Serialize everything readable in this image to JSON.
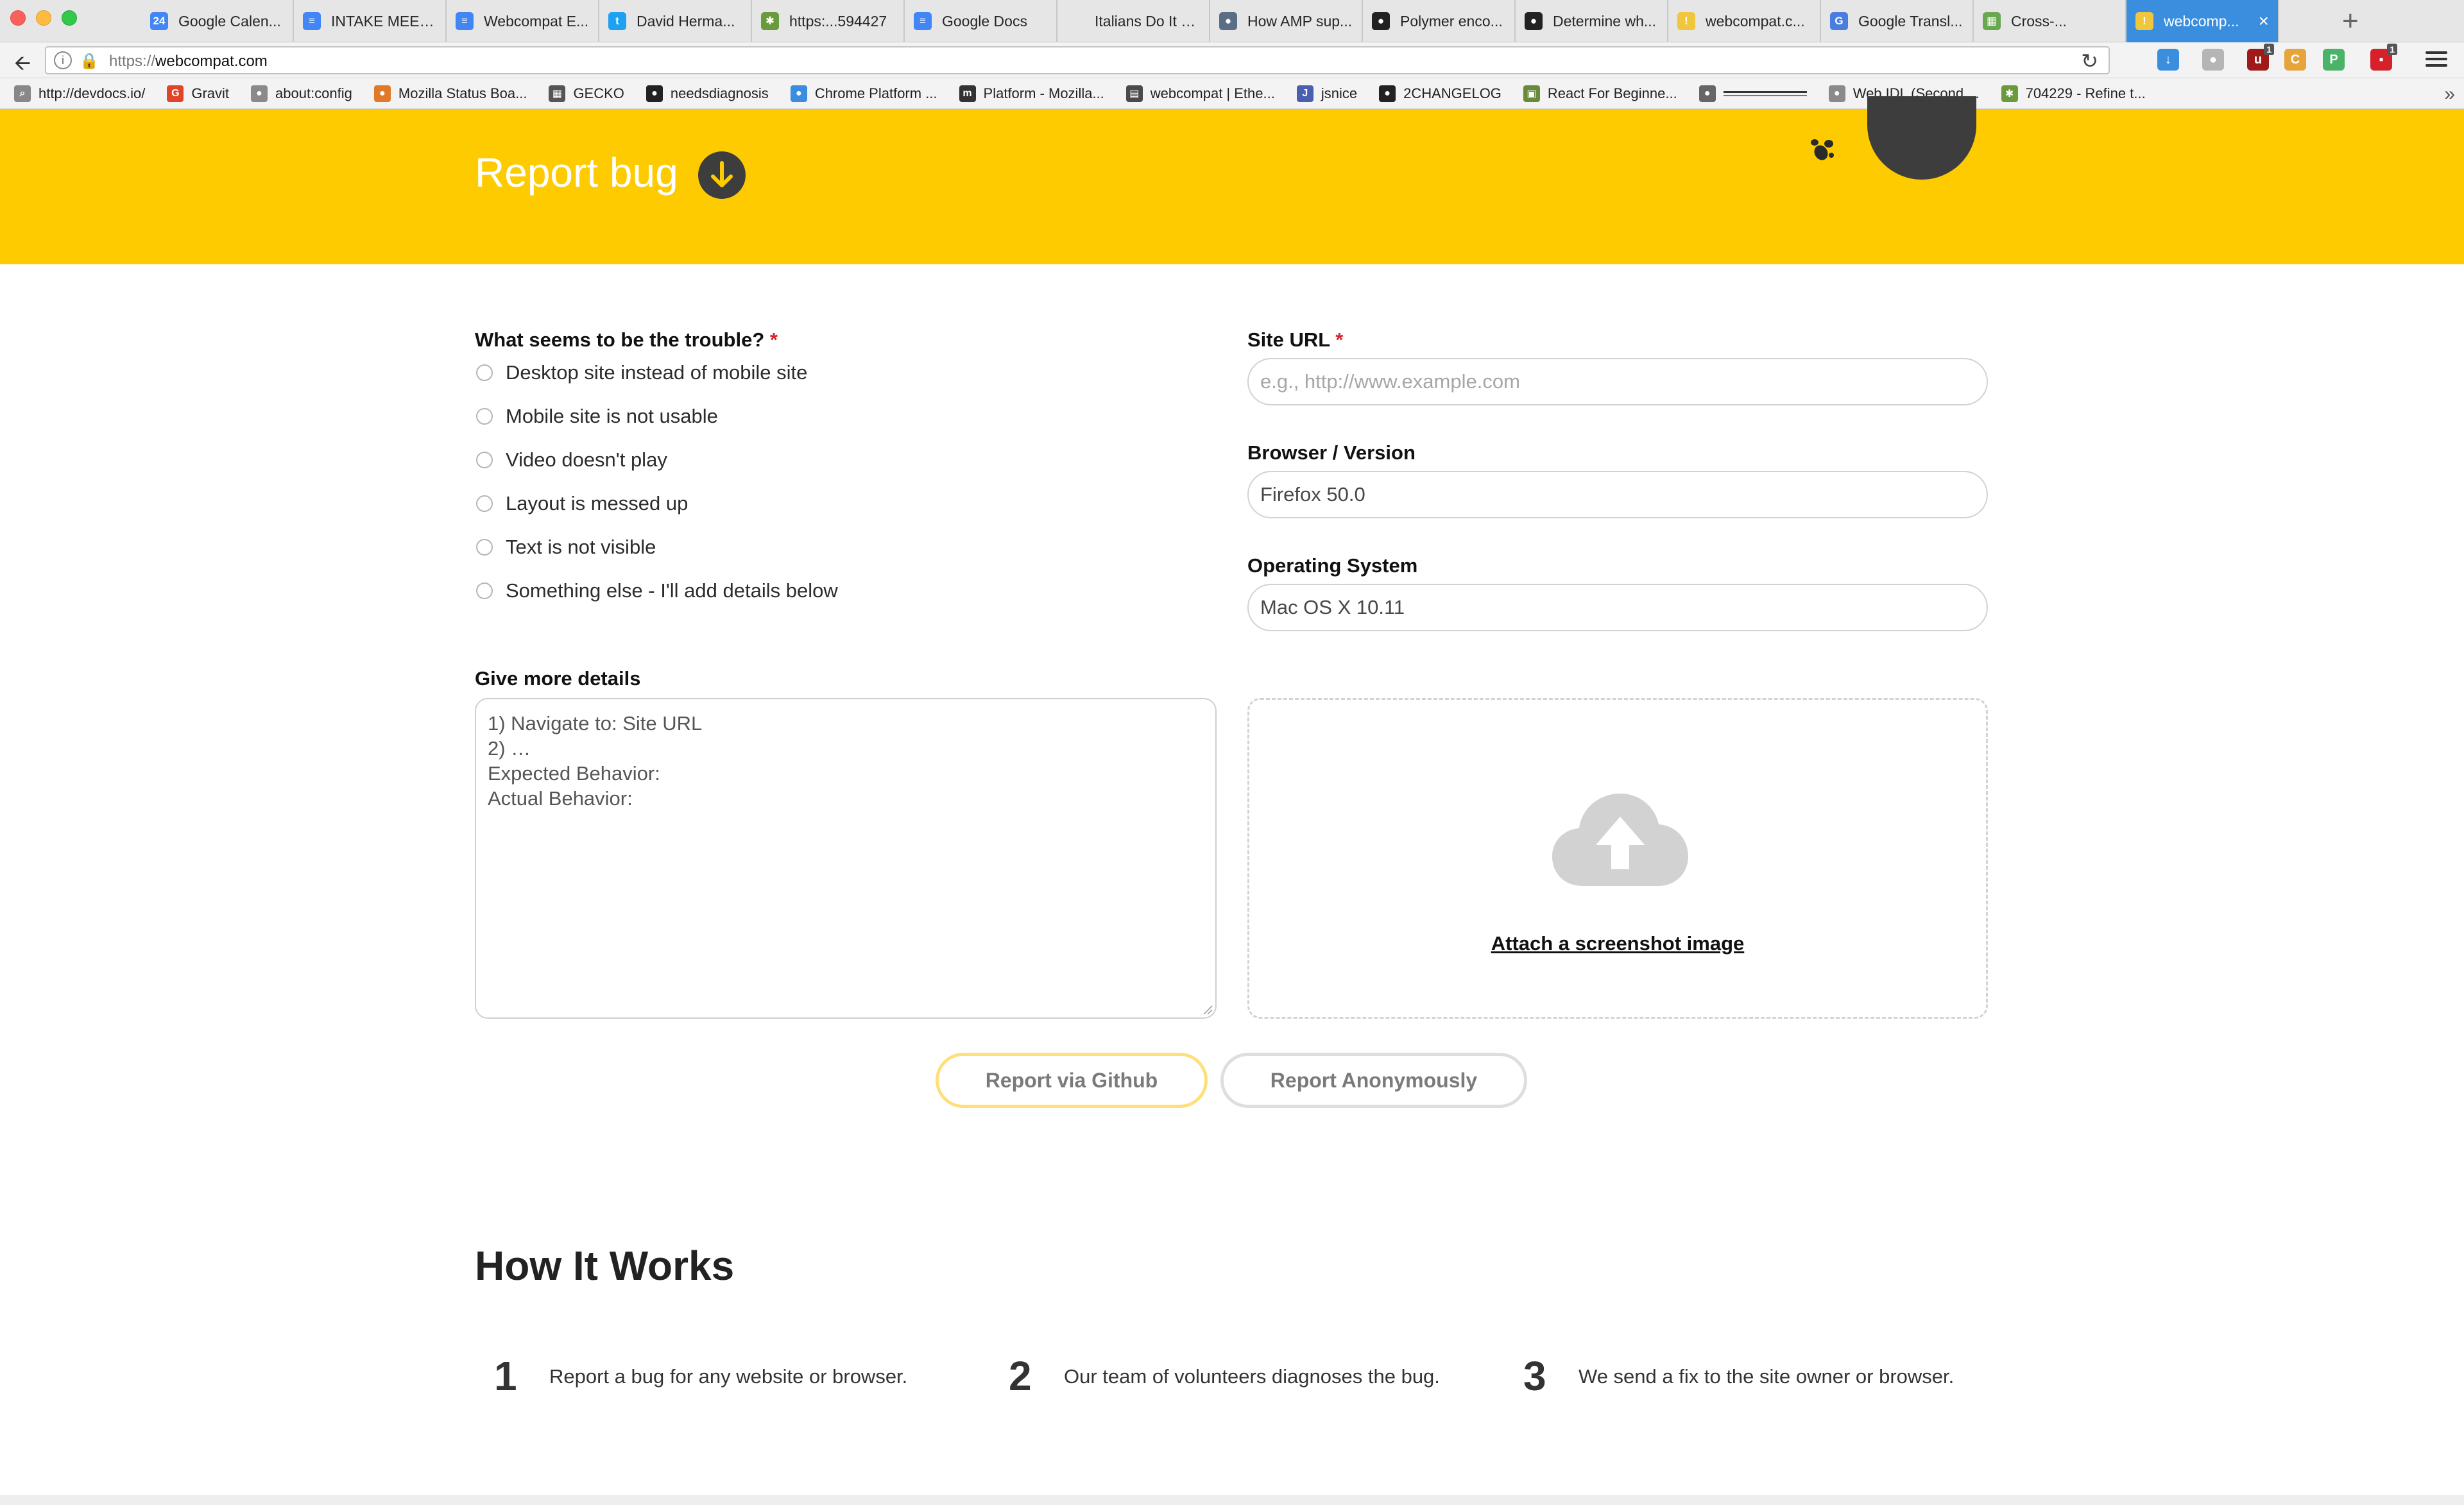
{
  "browser": {
    "tabs": [
      {
        "label": "Google Calen...",
        "icon": "calendar-icon",
        "color": "#4285f4",
        "glyph": "24"
      },
      {
        "label": "INTAKE MEET...",
        "icon": "docs-icon",
        "color": "#4285f4",
        "glyph": "≡"
      },
      {
        "label": "Webcompat E...",
        "icon": "docs-icon",
        "color": "#4285f4",
        "glyph": "≡"
      },
      {
        "label": "David Herma...",
        "icon": "twitter-icon",
        "color": "#1da1f2",
        "glyph": "t"
      },
      {
        "label": "https:...594427",
        "icon": "bug-icon",
        "color": "#6a9a3c",
        "glyph": "✱"
      },
      {
        "label": "Google Docs",
        "icon": "docs-icon",
        "color": "#4285f4",
        "glyph": "≡"
      },
      {
        "label": "Italians Do It Bett...",
        "icon": "blank-icon",
        "color": "#e6e6e6",
        "glyph": ""
      },
      {
        "label": "How AMP sup...",
        "icon": "globe-icon",
        "color": "#5a6e85",
        "glyph": "●"
      },
      {
        "label": "Polymer enco...",
        "icon": "github-icon",
        "color": "#222222",
        "glyph": "●"
      },
      {
        "label": "Determine wh...",
        "icon": "github-icon",
        "color": "#222222",
        "glyph": "●"
      },
      {
        "label": "webcompat.c...",
        "icon": "webcompat-icon",
        "color": "#f0c63c",
        "glyph": "!"
      },
      {
        "label": "Google Transl...",
        "icon": "translate-icon",
        "color": "#4a7de0",
        "glyph": "G"
      },
      {
        "label": "Cross-...",
        "icon": "table-icon",
        "color": "#6aa84f",
        "glyph": "▦"
      },
      {
        "label": "webcomp...",
        "icon": "webcompat-icon",
        "color": "#f0c63c",
        "glyph": "!",
        "active": true
      }
    ],
    "url_prefix": "https://",
    "url": "webcompat.com",
    "bookmarks": [
      {
        "label": "http://devdocs.io/",
        "icon": "search-icon",
        "color": "#888888",
        "glyph": "⌕"
      },
      {
        "label": "Gravit",
        "icon": "gravit-icon",
        "color": "#e0452a",
        "glyph": "G"
      },
      {
        "label": "about:config",
        "icon": "globe-icon",
        "color": "#8a8a8a",
        "glyph": "●"
      },
      {
        "label": "Mozilla Status Boa...",
        "icon": "firefox-icon",
        "color": "#e07a2a",
        "glyph": "●"
      },
      {
        "label": "GECKO",
        "icon": "grid-icon",
        "color": "#555555",
        "glyph": "▦"
      },
      {
        "label": "needsdiagnosis",
        "icon": "github-icon",
        "color": "#222222",
        "glyph": "●"
      },
      {
        "label": "Chrome Platform ...",
        "icon": "chrome-icon",
        "color": "#3a8de0",
        "glyph": "●"
      },
      {
        "label": "Platform - Mozilla...",
        "icon": "mozilla-icon",
        "color": "#333333",
        "glyph": "m"
      },
      {
        "label": "webcompat | Ethe...",
        "icon": "etherpad-icon",
        "color": "#4a4a4a",
        "glyph": "▤"
      },
      {
        "label": "jsnice",
        "icon": "jsnice-icon",
        "color": "#4a5fb0",
        "glyph": "J"
      },
      {
        "label": "2CHANGELOG",
        "icon": "github-icon",
        "color": "#222222",
        "glyph": "●"
      },
      {
        "label": "React For Beginne...",
        "icon": "react-icon",
        "color": "#6a8a3a",
        "glyph": "▣"
      },
      {
        "label": "",
        "icon": "bookmark-image-icon",
        "color": "#666666",
        "glyph": "●"
      },
      {
        "label": "Web IDL (Second ...",
        "icon": "globe-icon",
        "color": "#8a8a8a",
        "glyph": "●"
      },
      {
        "label": "704229 - Refine t...",
        "icon": "bug-icon",
        "color": "#6a9a3c",
        "glyph": "✱"
      }
    ],
    "toolbar_icons": [
      {
        "name": "downloads-icon",
        "color": "#3b8ede",
        "glyph": "↓",
        "badge": ""
      },
      {
        "name": "extension-gray-icon",
        "color": "#b5b5b5",
        "glyph": "●",
        "badge": ""
      },
      {
        "name": "ublock-icon",
        "color": "#a01a1a",
        "glyph": "u",
        "badge": "1"
      },
      {
        "name": "color-picker-icon",
        "color": "#e6a43a",
        "glyph": "C",
        "badge": ""
      },
      {
        "name": "pushbullet-icon",
        "color": "#4ab367",
        "glyph": "P",
        "badge": ""
      },
      {
        "name": "todo-icon",
        "color": "#d6202a",
        "glyph": "▪",
        "badge": "1"
      }
    ]
  },
  "page": {
    "hero_title": "Report bug",
    "form": {
      "trouble_label": "What seems to be the trouble?",
      "required_mark": "*",
      "options": [
        "Desktop site instead of mobile site",
        "Mobile site is not usable",
        "Video doesn't play",
        "Layout is messed up",
        "Text is not visible",
        "Something else - I'll add details below"
      ],
      "site_url_label": "Site URL",
      "site_url_placeholder": "e.g., http://www.example.com",
      "browser_label": "Browser / Version",
      "browser_value": "Firefox 50.0",
      "os_label": "Operating System",
      "os_value": "Mac OS X 10.11",
      "details_label": "Give more details",
      "details_lines": [
        "1) Navigate to: Site URL",
        "2) …",
        "",
        "Expected Behavior:",
        "",
        "Actual Behavior:"
      ],
      "attach_label": "Attach a screenshot image",
      "report_github": "Report via Github",
      "report_anonymous": "Report Anonymously"
    },
    "how_it_works": {
      "title": "How It Works",
      "steps": [
        {
          "number": "1",
          "text": "Report a bug for any website or browser."
        },
        {
          "number": "2",
          "text": "Our team of volunteers diagnoses the bug."
        },
        {
          "number": "3",
          "text": "We send a fix to the site owner or browser."
        }
      ]
    }
  },
  "colors": {
    "brand_yellow": "#fecb00",
    "dark": "#3d3d3d",
    "required": "#d9252b",
    "github_button_border": "#fde07a",
    "tab_active": "#3b8ede"
  }
}
